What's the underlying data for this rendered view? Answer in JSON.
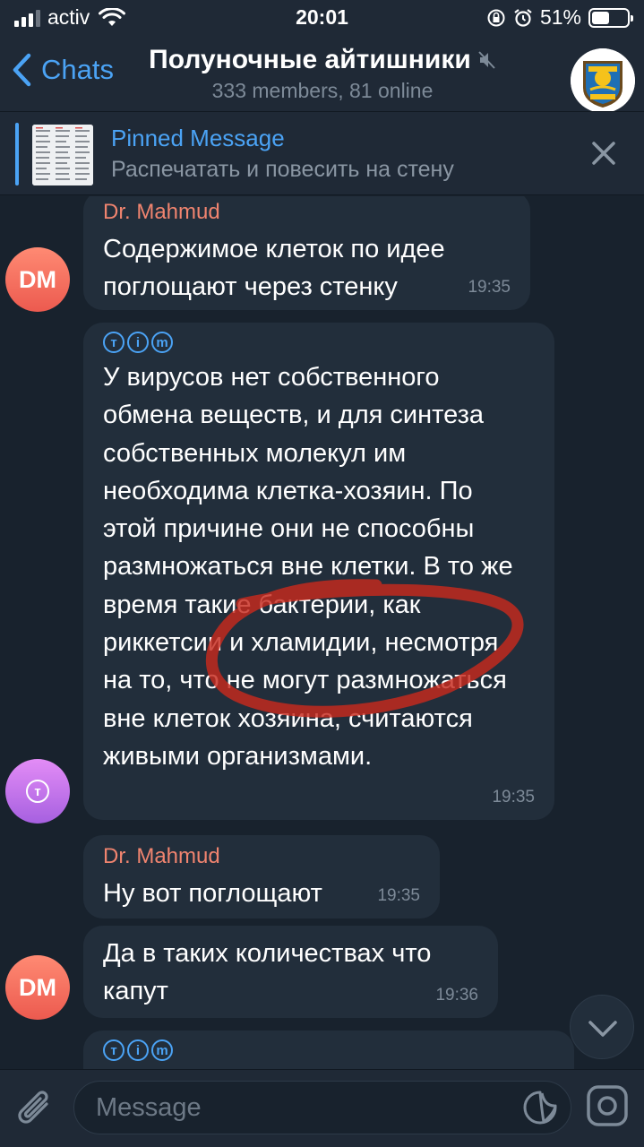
{
  "status_bar": {
    "carrier": "activ",
    "time": "20:01",
    "battery": "51%",
    "battery_level": 0.51
  },
  "header": {
    "back_label": "Chats",
    "title": "Полуночные айтишники",
    "subtitle": "333 members, 81 online",
    "avatar_icon": "group-avatar-kazakhstan-emblem",
    "muted_icon": "muted-speaker-icon"
  },
  "pinned": {
    "title": "Pinned Message",
    "text": "Распечатать и повесить на стену"
  },
  "messages": [
    {
      "sender": "Dr. Mahmud",
      "text": "Содержимое клеток по идее поглощают через стенку",
      "time": "19:35",
      "avatar": "DM"
    },
    {
      "sender_badges": [
        "т",
        "i",
        "m"
      ],
      "text": "У вирусов нет собственного обмена веществ, и для синтеза собственных молекул им необходима клетка-хозяин. По этой причине они не способны размножаться вне клетки. В то же время такие бактерии, как риккетсии и хламидии, несмотря на то, что не могут размножаться вне клеток хозяина, считаются живыми организмами.",
      "time": "19:35",
      "avatar_glyph": "т"
    },
    {
      "sender": "Dr. Mahmud",
      "text": "Ну вот поглощают",
      "time": "19:35"
    },
    {
      "text": "Да в таких количествах что капут",
      "time": "19:36",
      "avatar": "DM"
    },
    {
      "sender_badges": [
        "т",
        "i",
        "m"
      ]
    }
  ],
  "composer": {
    "placeholder": "Message"
  },
  "colors": {
    "accent": "#4ba3f5",
    "sender_name": "#f0846f",
    "bubble": "#222e3b",
    "background": "#18222d",
    "annotation_circle": "#c7291d"
  }
}
